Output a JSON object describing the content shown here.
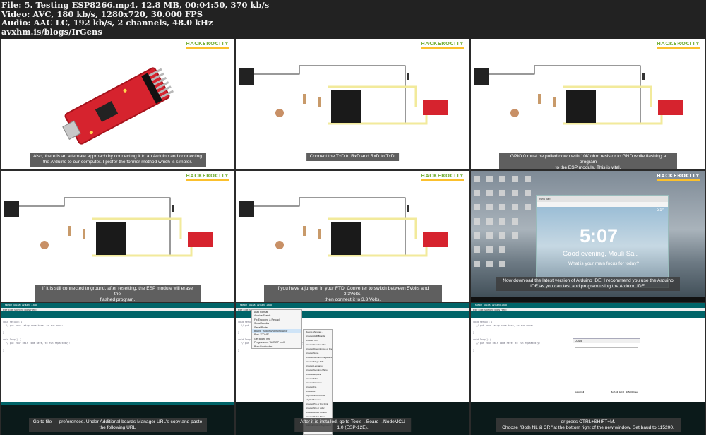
{
  "header": {
    "file": "File: 5. Testing ESP8266.mp4, 12.8 MB, 00:04:50, 370 kb/s",
    "video": "Video: AVC, 180 kb/s, 1280x720, 30.000 FPS",
    "audio": "Audio: AAC LC, 192 kb/s, 2 channels, 48.0 kHz",
    "site": "avxhm.is/blogs/IrGens"
  },
  "logo": "HACKEROCITY",
  "captions": {
    "t1": "Also, there is an alternate approach by connecting it to an Arduino and connecting\nthe Arduino to our computer. I prefer the former method which is simpler.",
    "t2": "Connect the TxD to RxD and RxD to TxD.",
    "t3": "GPIO 0 must be pulled down with 10K ohm resistor to GND while flashing a program\nto the ESP module. This is vital.",
    "t4": "If it is still connected to ground, after resetting, the ESP module will erase the\nflashed program.",
    "t5": "If you have a jumper in your FTDI Converter to switch between 5Volts and 3.3Volts,\nthen connect it to 3.3 Volts.",
    "t6": "Now download the latest version of Arduino IDE. I recommend you use the Arduino\nIDE as you can test and program using the Arduino IDE.",
    "t7": "Go to file → preferences. Under Additional boards Manager URL's copy and paste\nthe following URL",
    "t8": "After it is installed, go to Tools→Board→NodeMCU 1.0 (ESP-12E).",
    "t9": "or press CTRL+SHIFT+M.\nChoose \"Both NL & CR \"at the bottom right of the new window. Set baud to 115200."
  },
  "desktop": {
    "time": "5:07",
    "greeting": "Good evening, Mouli Sai.",
    "focus": "What is your main focus for today?",
    "temp": "31°",
    "tab": "New Tab"
  },
  "ide": {
    "title": "sketch_jul15a | Arduino 1.6.8",
    "menu": "File Edit Sketch Tools Help",
    "code1": "void setup() {\n  // put your setup code here, to run once:\n\n}",
    "code2": "void loop() {\n  // put your main code here, to run repeatedly:\n\n}",
    "tools_menu": [
      "Auto Format",
      "Archive Sketch",
      "Fix Encoding & Reload",
      "Serial Monitor",
      "Serial Plotter",
      "Board: \"Arduino/Genuino Uno\"",
      "Port: \"COM5\"",
      "Get Board Info",
      "Programmer: \"AVRISP mkII\"",
      "Burn Bootloader"
    ],
    "boards_menu": [
      "Boards Manager...",
      "Arduino AVR Boards",
      "Arduino Yún",
      "Arduino/Genuino Uno",
      "Arduino Duemilanove or Diecimila",
      "Arduino Nano",
      "Arduino/Genuino Mega or Mega 2560",
      "Arduino Mega ADK",
      "Arduino Leonardo",
      "Arduino/Genuino Micro",
      "Arduino Esplora",
      "Arduino Mini",
      "Arduino Ethernet",
      "Arduino Fio",
      "Arduino BT",
      "LilyPad Arduino USB",
      "LilyPad Arduino",
      "Arduino Pro or Pro Mini",
      "Arduino NG or older",
      "Arduino Robot Control",
      "Arduino Robot Motor",
      "Arduino Gemma",
      "Adafruit Circuit Playground"
    ],
    "serial_title": "COM5",
    "serial_autoscroll": "Autoscroll",
    "serial_nl": "Both NL & CR",
    "serial_baud": "115200 baud"
  },
  "colors": {
    "ide_teal": "#006468",
    "caption_bg": "#3c3c3c",
    "circuit_yellow": "#f2ea9b"
  }
}
